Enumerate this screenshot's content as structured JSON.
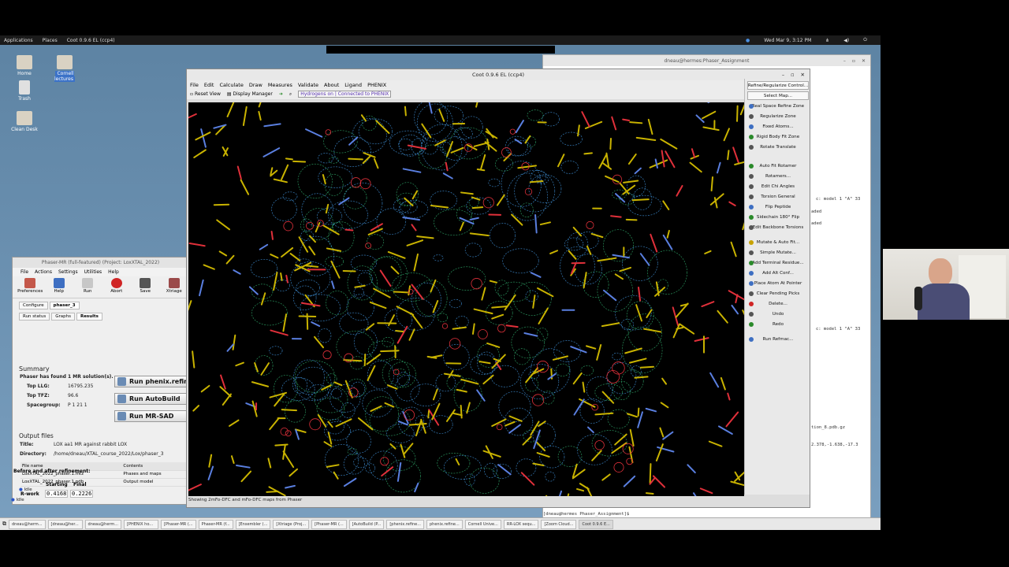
{
  "topbar": {
    "applications": "Applications",
    "places": "Places",
    "app_name": "Coot 0.9.6 EL (ccp4)",
    "datetime": "Wed Mar 9,  3:12 PM"
  },
  "desktop": {
    "icons": [
      "Home",
      "Cornell lectures",
      "Trash",
      "Clean Desk"
    ]
  },
  "terminal": {
    "title": "dneau@hermes:Phaser_Assignment",
    "lines": [
      "c: model 1 \"A\"  33",
      "aded",
      "aded",
      "c: model 1 \"A\"  33",
      "tion_8.pdb.gz",
      "2.378,-1.638,-17.3",
      "[dneau@hermes Phaser_Assignment]$"
    ]
  },
  "phaser": {
    "title": "Phaser-MR (full-featured) (Project: LoxXTAL_2022)",
    "menu": [
      "File",
      "Actions",
      "Settings",
      "Utilities",
      "Help"
    ],
    "toolbar": [
      "Preferences",
      "Help",
      "Run",
      "Abort",
      "Save",
      "Xtriage"
    ],
    "top_tabs": [
      "Configure",
      "phaser_3"
    ],
    "sub_tabs": [
      "Run status",
      "Graphs",
      "Results"
    ],
    "summary_heading": "Summary",
    "found": "Phaser has found 1 MR solution(s).",
    "stats": [
      {
        "label": "Top LLG:",
        "value": "16795.235"
      },
      {
        "label": "Top TFZ:",
        "value": "96.6"
      },
      {
        "label": "Spacegroup:",
        "value": "P 1 21 1"
      }
    ],
    "buttons": [
      "Run phenix.refine",
      "Run AutoBuild",
      "Run MR-SAD"
    ],
    "output_heading": "Output files",
    "title_label": "Title:",
    "title_value": "LOX aa1 MR against rabbit LOX",
    "dir_label": "Directory:",
    "dir_value": "/home/dneau/XTAL_course_2022/Lox/phaser_3",
    "files_header": [
      "File name",
      "Contents"
    ],
    "files": [
      {
        "name": "LoxXTAL_2022_phaser.1.mtz",
        "contents": "Phases and maps"
      },
      {
        "name": "LoxXTAL_2022_phaser.1.pdb",
        "contents": "Output model"
      }
    ],
    "idle1": "Idle",
    "before_after": "Before and after refinement:",
    "rwork_header": [
      "Starting",
      "Final"
    ],
    "rwork_label": "R-work",
    "rwork_values": [
      "0.4168",
      "0.2226"
    ],
    "idle2": "Idle"
  },
  "coot": {
    "title": "Coot 0.9.6 EL (ccp4)",
    "menu": [
      "File",
      "Edit",
      "Calculate",
      "Draw",
      "Measures",
      "Validate",
      "About",
      "Ligand",
      "PHENIX"
    ],
    "toolbar": {
      "reset": "Reset View",
      "display": "Display Manager",
      "hydrogens": "Hydrogens on",
      "phenix": "Connected to PHENIX"
    },
    "status": "Showing 2mFo-DFC and mFo-DFC maps from Phaser",
    "side": [
      "Refine/Regularize Control...",
      "Select Map...",
      "Real Space Refine Zone",
      "Regularize Zone",
      "Fixed Atoms...",
      "Rigid Body Fit Zone",
      "Rotate Translate",
      "Auto Fit Rotamer",
      "Rotamers...",
      "Edit Chi Angles",
      "Torsion General",
      "Flip Peptide",
      "Sidechain 180° Flip",
      "Edit Backbone Torsions",
      "Mutate & Auto Fit...",
      "Simple Mutate...",
      "Add Terminal Residue...",
      "Add Alt Conf...",
      "Place Atom At Pointer",
      "Clear Pending Picks",
      "Delete...",
      "Undo",
      "Redo",
      "Run Refmac..."
    ]
  },
  "taskbar": [
    "dneau@herm...",
    "[dneau@her...",
    "dneau@herm...",
    "[PHENIX ho...",
    "[Phaser-MR (...",
    "Phaser-MR (f...",
    "[Ensembler (...",
    "[Xtriage (Proj...",
    "[Phaser-MR (...",
    "[AutoBuild (P...",
    "[phenix.refine...",
    "phenix.refine...",
    "Cornell Unive...",
    "RR-LOX sequ...",
    "[Zoom Cloud...",
    "Coot 0.9.6 E..."
  ],
  "colors": {
    "desktop": "#6b8fb0",
    "map_blue": "#3e8fd6",
    "map_green": "#2fa86a",
    "bond_yellow": "#c9b300",
    "bond_red": "#e0303a"
  }
}
